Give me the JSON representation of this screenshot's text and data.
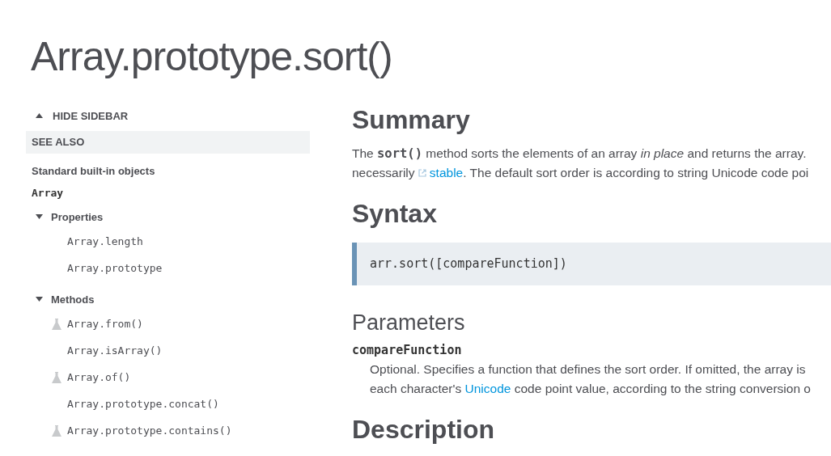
{
  "title": "Array.prototype.sort()",
  "sidebar": {
    "toggle": "HIDE SIDEBAR",
    "see_also": "SEE ALSO",
    "group": "Standard built-in objects",
    "object": "Array",
    "sections": [
      {
        "label": "Properties",
        "expanded": true,
        "children": [
          {
            "label": "Array.length",
            "experimental": false
          },
          {
            "label": "Array.prototype",
            "experimental": false
          }
        ]
      },
      {
        "label": "Methods",
        "expanded": true,
        "children": [
          {
            "label": "Array.from()",
            "experimental": true
          },
          {
            "label": "Array.isArray()",
            "experimental": false
          },
          {
            "label": "Array.of()",
            "experimental": true
          },
          {
            "label": "Array.prototype.concat()",
            "experimental": false
          },
          {
            "label": "Array.prototype.contains()",
            "experimental": true
          }
        ]
      }
    ]
  },
  "content": [
    {
      "kind": "h2",
      "text": "Summary"
    },
    {
      "kind": "para",
      "lines": [
        [
          {
            "kind": "text",
            "text": "The **sort()** method sorts the elements of an array *in place* and returns the array."
          }
        ],
        [
          {
            "kind": "text",
            "text": "necessarily "
          },
          {
            "kind": "link",
            "text": "stable",
            "external": true
          },
          {
            "kind": "text",
            "text": ". The default sort order is according to string Unicode code poi"
          }
        ]
      ]
    },
    {
      "kind": "h2",
      "text": "Syntax"
    },
    {
      "kind": "code",
      "text": "arr.sort([compareFunction])"
    },
    {
      "kind": "h3",
      "text": "Parameters"
    },
    {
      "kind": "term",
      "text": "compareFunction"
    },
    {
      "kind": "def",
      "lines": [
        [
          {
            "kind": "text",
            "text": "Optional. Specifies a function that defines the sort order. If omitted, the array is"
          }
        ],
        [
          {
            "kind": "text",
            "text": "each character's "
          },
          {
            "kind": "link",
            "text": "Unicode",
            "external": false
          },
          {
            "kind": "text",
            "text": " code point value, according to the string conversion o"
          }
        ]
      ]
    },
    {
      "kind": "h2",
      "text": "Description"
    }
  ]
}
